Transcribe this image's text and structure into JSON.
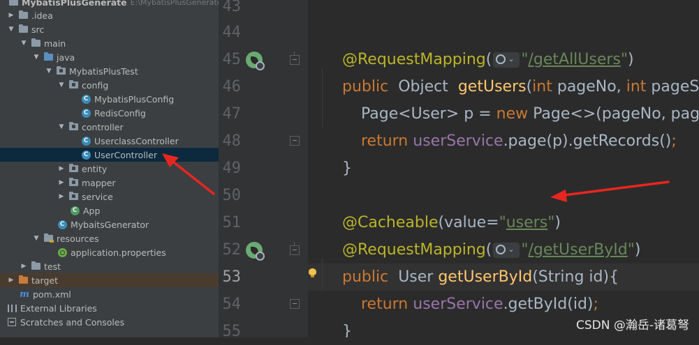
{
  "project_tree": {
    "root": {
      "label": "MybatisPlusGenerate",
      "path": "E:\\MybatisPlusGenerate"
    },
    "items": [
      {
        "label": ".idea",
        "icon": "folder-icon"
      },
      {
        "label": "src",
        "icon": "folder-icon"
      },
      {
        "label": "main",
        "icon": "folder-icon"
      },
      {
        "label": "java",
        "icon": "source-folder-icon"
      },
      {
        "label": "MybatisPlusTest",
        "icon": "package-icon"
      },
      {
        "label": "config",
        "icon": "package-icon"
      },
      {
        "label": "MybatisPlusConfig",
        "icon": "class-icon"
      },
      {
        "label": "RedisConfig",
        "icon": "class-icon"
      },
      {
        "label": "controller",
        "icon": "package-icon"
      },
      {
        "label": "UserclassController",
        "icon": "class-icon"
      },
      {
        "label": "UserController",
        "icon": "class-icon",
        "selected": true
      },
      {
        "label": "entity",
        "icon": "package-icon"
      },
      {
        "label": "mapper",
        "icon": "package-icon"
      },
      {
        "label": "service",
        "icon": "package-icon"
      },
      {
        "label": "App",
        "icon": "spring-class-icon"
      },
      {
        "label": "MybaitsGenerator",
        "icon": "class-icon"
      },
      {
        "label": "resources",
        "icon": "resources-folder-icon"
      },
      {
        "label": "application.properties",
        "icon": "spring-properties-icon"
      },
      {
        "label": "test",
        "icon": "folder-icon"
      },
      {
        "label": "target",
        "icon": "excluded-folder-icon"
      },
      {
        "label": "pom.xml",
        "icon": "maven-icon"
      },
      {
        "label": "External Libraries",
        "icon": "libraries-icon"
      },
      {
        "label": "Scratches and Consoles",
        "icon": "scratches-icon"
      }
    ]
  },
  "gutter": {
    "line_numbers": [
      "43",
      "44",
      "45",
      "46",
      "47",
      "48",
      "49",
      "50",
      "51",
      "52",
      "53",
      "54",
      "55"
    ],
    "current_line": "53"
  },
  "code": {
    "l44": {
      "ann": "@RequestMapping",
      "open": "(",
      "q1": "\"",
      "url": "/getAllUsers",
      "q2": "\"",
      "close": ")"
    },
    "l45": {
      "kw": "public",
      "type": "Object",
      "fn": "getUsers",
      "p1": "(",
      "int1": "int",
      "a1": "pageNo, ",
      "int2": "int",
      "a2": "pageSiz"
    },
    "l46": {
      "t1": "Page<User> p = ",
      "kw": "new",
      "t2": "Page<>(pageNo, page"
    },
    "l47": {
      "kw": "return",
      "fld": "userService",
      "rest": ".page(p).getRecords()",
      "semi": ";"
    },
    "l48": {
      "brace": "}"
    },
    "l50": {
      "ann": "@Cacheable",
      "open": "(value=",
      "q1": "\"",
      "val": "users",
      "q2": "\"",
      "close": ")"
    },
    "l51": {
      "ann": "@RequestMapping",
      "open": "(",
      "q1": "\"",
      "url": "/getUserById",
      "q2": "\"",
      "close": ")"
    },
    "l52": {
      "kw": "public",
      "type": "User",
      "fn": "getUserById",
      "rest": "(String id){"
    },
    "l53": {
      "kw": "return",
      "fld": "userService",
      "rest": ".getById(id)",
      "semi": ";"
    },
    "l54": {
      "brace": "}"
    }
  },
  "hint_chevron": "⌄",
  "watermark": "CSDN @瀚岳-诸葛弩",
  "colors": {
    "editor_bg": "#2b2b2b",
    "tree_bg": "#3c3f41",
    "keyword": "#cc7832",
    "annotation": "#bbb529",
    "string": "#6a8759",
    "method": "#ffc66d",
    "field": "#9876aa",
    "arrow": "#e8261f"
  }
}
